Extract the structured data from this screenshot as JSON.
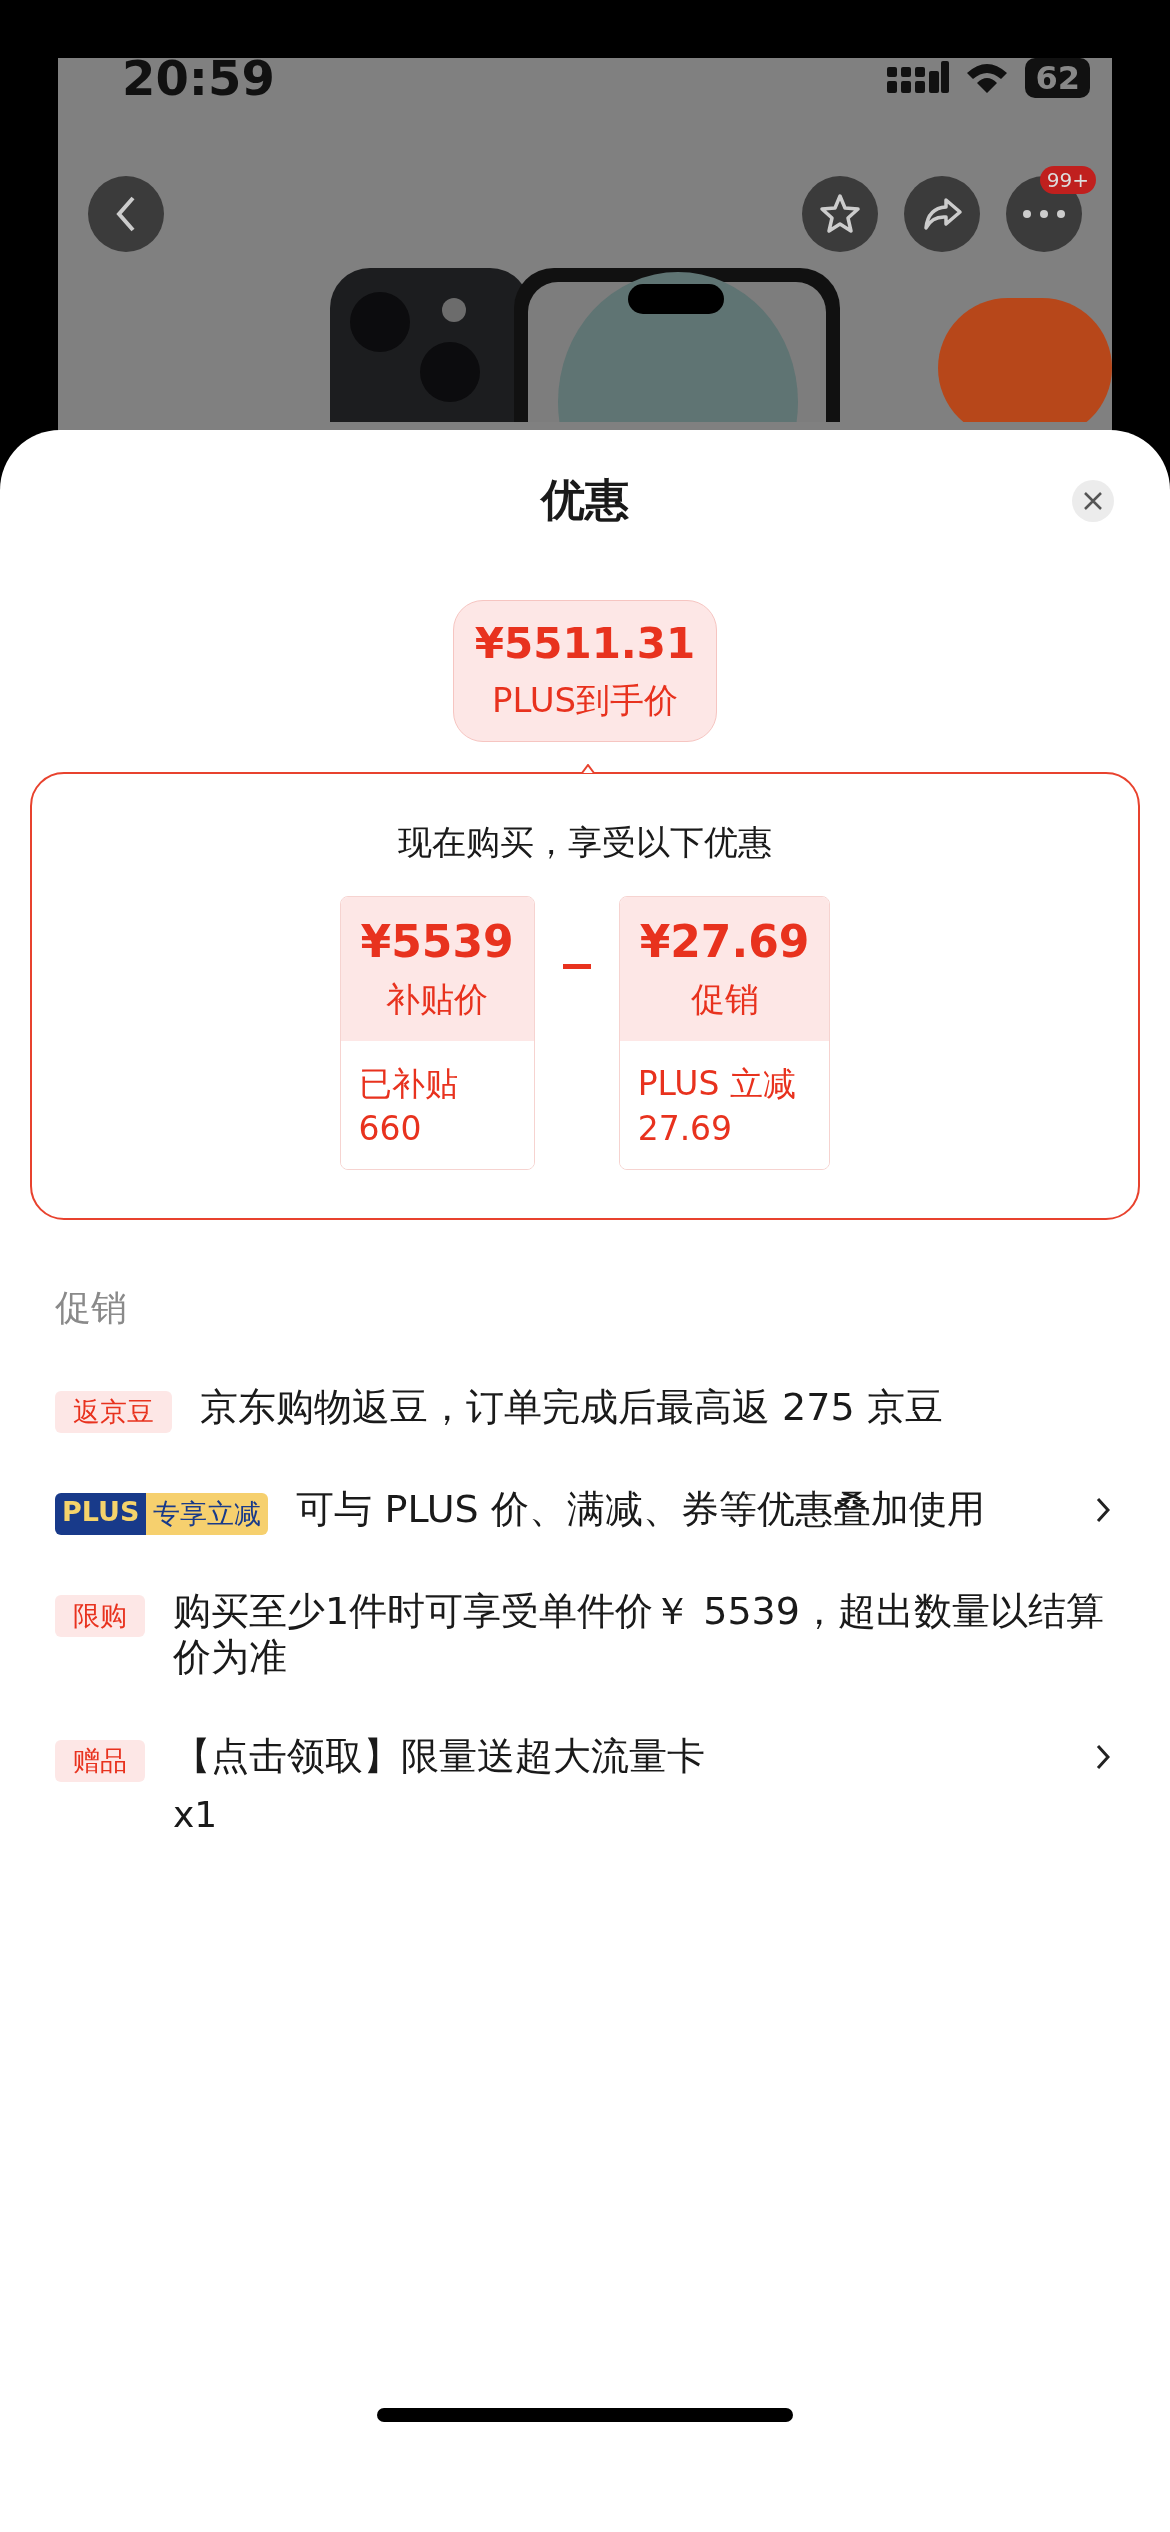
{
  "status_bar": {
    "time": "20:59",
    "battery": "62"
  },
  "top_bar": {
    "more_badge": "99+"
  },
  "sheet": {
    "title": "优惠"
  },
  "final_price": {
    "amount": "¥5511.31",
    "label": "PLUS到手价"
  },
  "breakdown": {
    "heading": "现在购买，享受以下优惠",
    "items": [
      {
        "amount": "¥5539",
        "label": "补贴价",
        "note_label": "已补贴",
        "note_value": "660"
      },
      {
        "amount": "¥27.69",
        "label": "促销",
        "note_label": "PLUS 立减",
        "note_value": "27.69"
      }
    ]
  },
  "promotions": {
    "title": "促销",
    "items": [
      {
        "kind": "plain",
        "tag": "返京豆",
        "text": "京东购物返豆，订单完成后最高返 275 京豆",
        "has_arrow": false
      },
      {
        "kind": "plus",
        "tag_prefix": "PLUS",
        "tag": "专享立减",
        "text": "可与 PLUS 价、满减、券等优惠叠加使用",
        "has_arrow": true
      },
      {
        "kind": "plain",
        "tag": "限购",
        "text": "购买至少1件时可享受单件价￥ 5539，超出数量以结算价为准",
        "has_arrow": false
      },
      {
        "kind": "plain",
        "tag": "赠品",
        "text": "【点击领取】限量送超大流量卡",
        "sub": "x1",
        "has_arrow": true
      }
    ]
  }
}
